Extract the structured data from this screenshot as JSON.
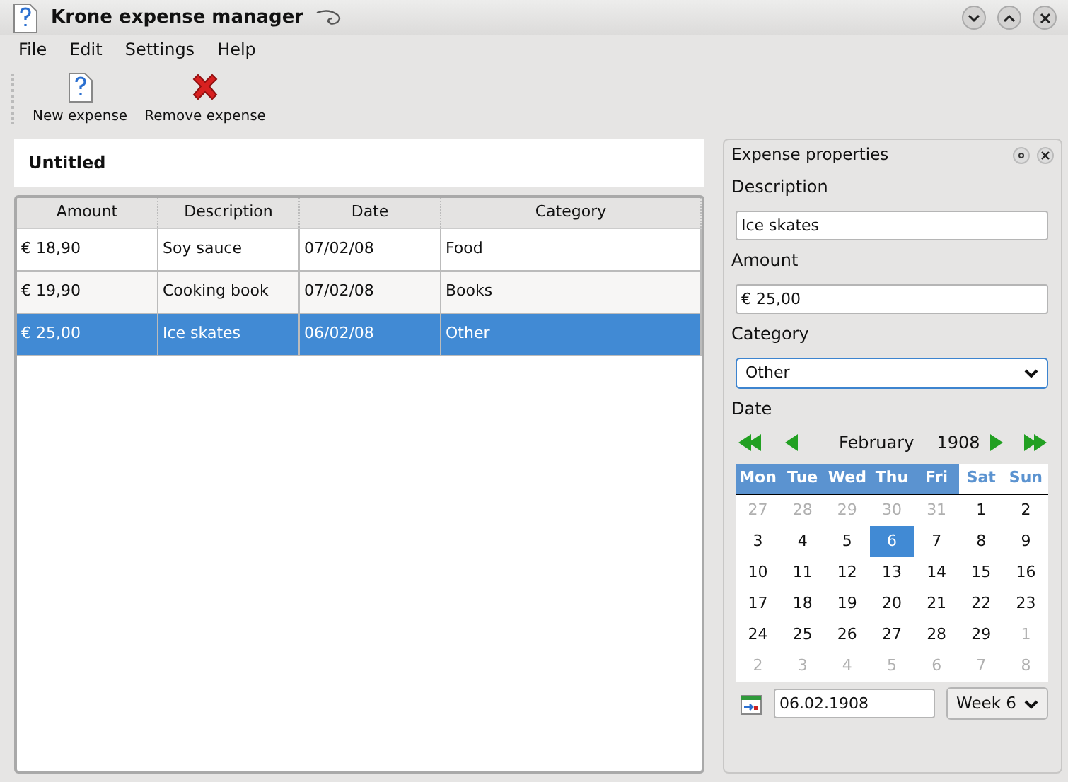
{
  "window": {
    "title": "Krone expense manager"
  },
  "menu": [
    "File",
    "Edit",
    "Settings",
    "Help"
  ],
  "toolbar": [
    {
      "kind": "new",
      "label": "New expense"
    },
    {
      "kind": "remove",
      "label": "Remove expense"
    }
  ],
  "document": {
    "title": "Untitled"
  },
  "table": {
    "columns": [
      "Amount",
      "Description",
      "Date",
      "Category"
    ],
    "rows": [
      {
        "cells": [
          "€ 18,90",
          "Soy sauce",
          "07/02/08",
          "Food"
        ],
        "selected": false
      },
      {
        "cells": [
          "€ 19,90",
          "Cooking book",
          "07/02/08",
          "Books"
        ],
        "selected": false
      },
      {
        "cells": [
          "€ 25,00",
          "Ice skates",
          "06/02/08",
          "Other"
        ],
        "selected": true
      }
    ]
  },
  "properties": {
    "title": "Expense properties",
    "description": {
      "label": "Description",
      "value": "Ice skates"
    },
    "amount": {
      "label": "Amount",
      "value": "€ 25,00"
    },
    "category": {
      "label": "Category",
      "value": "Other"
    },
    "date": {
      "label": "Date",
      "month": "February",
      "year": "1908",
      "weekdays": [
        {
          "text": "Mon",
          "weekend": false
        },
        {
          "text": "Tue",
          "weekend": false
        },
        {
          "text": "Wed",
          "weekend": false
        },
        {
          "text": "Thu",
          "weekend": false
        },
        {
          "text": "Fri",
          "weekend": false
        },
        {
          "text": "Sat",
          "weekend": true
        },
        {
          "text": "Sun",
          "weekend": true
        }
      ],
      "weeks": [
        [
          {
            "text": "27",
            "muted": true,
            "selected": false
          },
          {
            "text": "28",
            "muted": true,
            "selected": false
          },
          {
            "text": "29",
            "muted": true,
            "selected": false
          },
          {
            "text": "30",
            "muted": true,
            "selected": false
          },
          {
            "text": "31",
            "muted": true,
            "selected": false
          },
          {
            "text": "1",
            "muted": false,
            "selected": false
          },
          {
            "text": "2",
            "muted": false,
            "selected": false
          }
        ],
        [
          {
            "text": "3",
            "muted": false,
            "selected": false
          },
          {
            "text": "4",
            "muted": false,
            "selected": false
          },
          {
            "text": "5",
            "muted": false,
            "selected": false
          },
          {
            "text": "6",
            "muted": false,
            "selected": true
          },
          {
            "text": "7",
            "muted": false,
            "selected": false
          },
          {
            "text": "8",
            "muted": false,
            "selected": false
          },
          {
            "text": "9",
            "muted": false,
            "selected": false
          }
        ],
        [
          {
            "text": "10",
            "muted": false,
            "selected": false
          },
          {
            "text": "11",
            "muted": false,
            "selected": false
          },
          {
            "text": "12",
            "muted": false,
            "selected": false
          },
          {
            "text": "13",
            "muted": false,
            "selected": false
          },
          {
            "text": "14",
            "muted": false,
            "selected": false
          },
          {
            "text": "15",
            "muted": false,
            "selected": false
          },
          {
            "text": "16",
            "muted": false,
            "selected": false
          }
        ],
        [
          {
            "text": "17",
            "muted": false,
            "selected": false
          },
          {
            "text": "18",
            "muted": false,
            "selected": false
          },
          {
            "text": "19",
            "muted": false,
            "selected": false
          },
          {
            "text": "20",
            "muted": false,
            "selected": false
          },
          {
            "text": "21",
            "muted": false,
            "selected": false
          },
          {
            "text": "22",
            "muted": false,
            "selected": false
          },
          {
            "text": "23",
            "muted": false,
            "selected": false
          }
        ],
        [
          {
            "text": "24",
            "muted": false,
            "selected": false
          },
          {
            "text": "25",
            "muted": false,
            "selected": false
          },
          {
            "text": "26",
            "muted": false,
            "selected": false
          },
          {
            "text": "27",
            "muted": false,
            "selected": false
          },
          {
            "text": "28",
            "muted": false,
            "selected": false
          },
          {
            "text": "29",
            "muted": false,
            "selected": false
          },
          {
            "text": "1",
            "muted": true,
            "selected": false
          }
        ],
        [
          {
            "text": "2",
            "muted": true,
            "selected": false
          },
          {
            "text": "3",
            "muted": true,
            "selected": false
          },
          {
            "text": "4",
            "muted": true,
            "selected": false
          },
          {
            "text": "5",
            "muted": true,
            "selected": false
          },
          {
            "text": "6",
            "muted": true,
            "selected": false
          },
          {
            "text": "7",
            "muted": true,
            "selected": false
          },
          {
            "text": "8",
            "muted": true,
            "selected": false
          }
        ]
      ],
      "value": "06.02.1908",
      "week": "Week 6"
    }
  }
}
